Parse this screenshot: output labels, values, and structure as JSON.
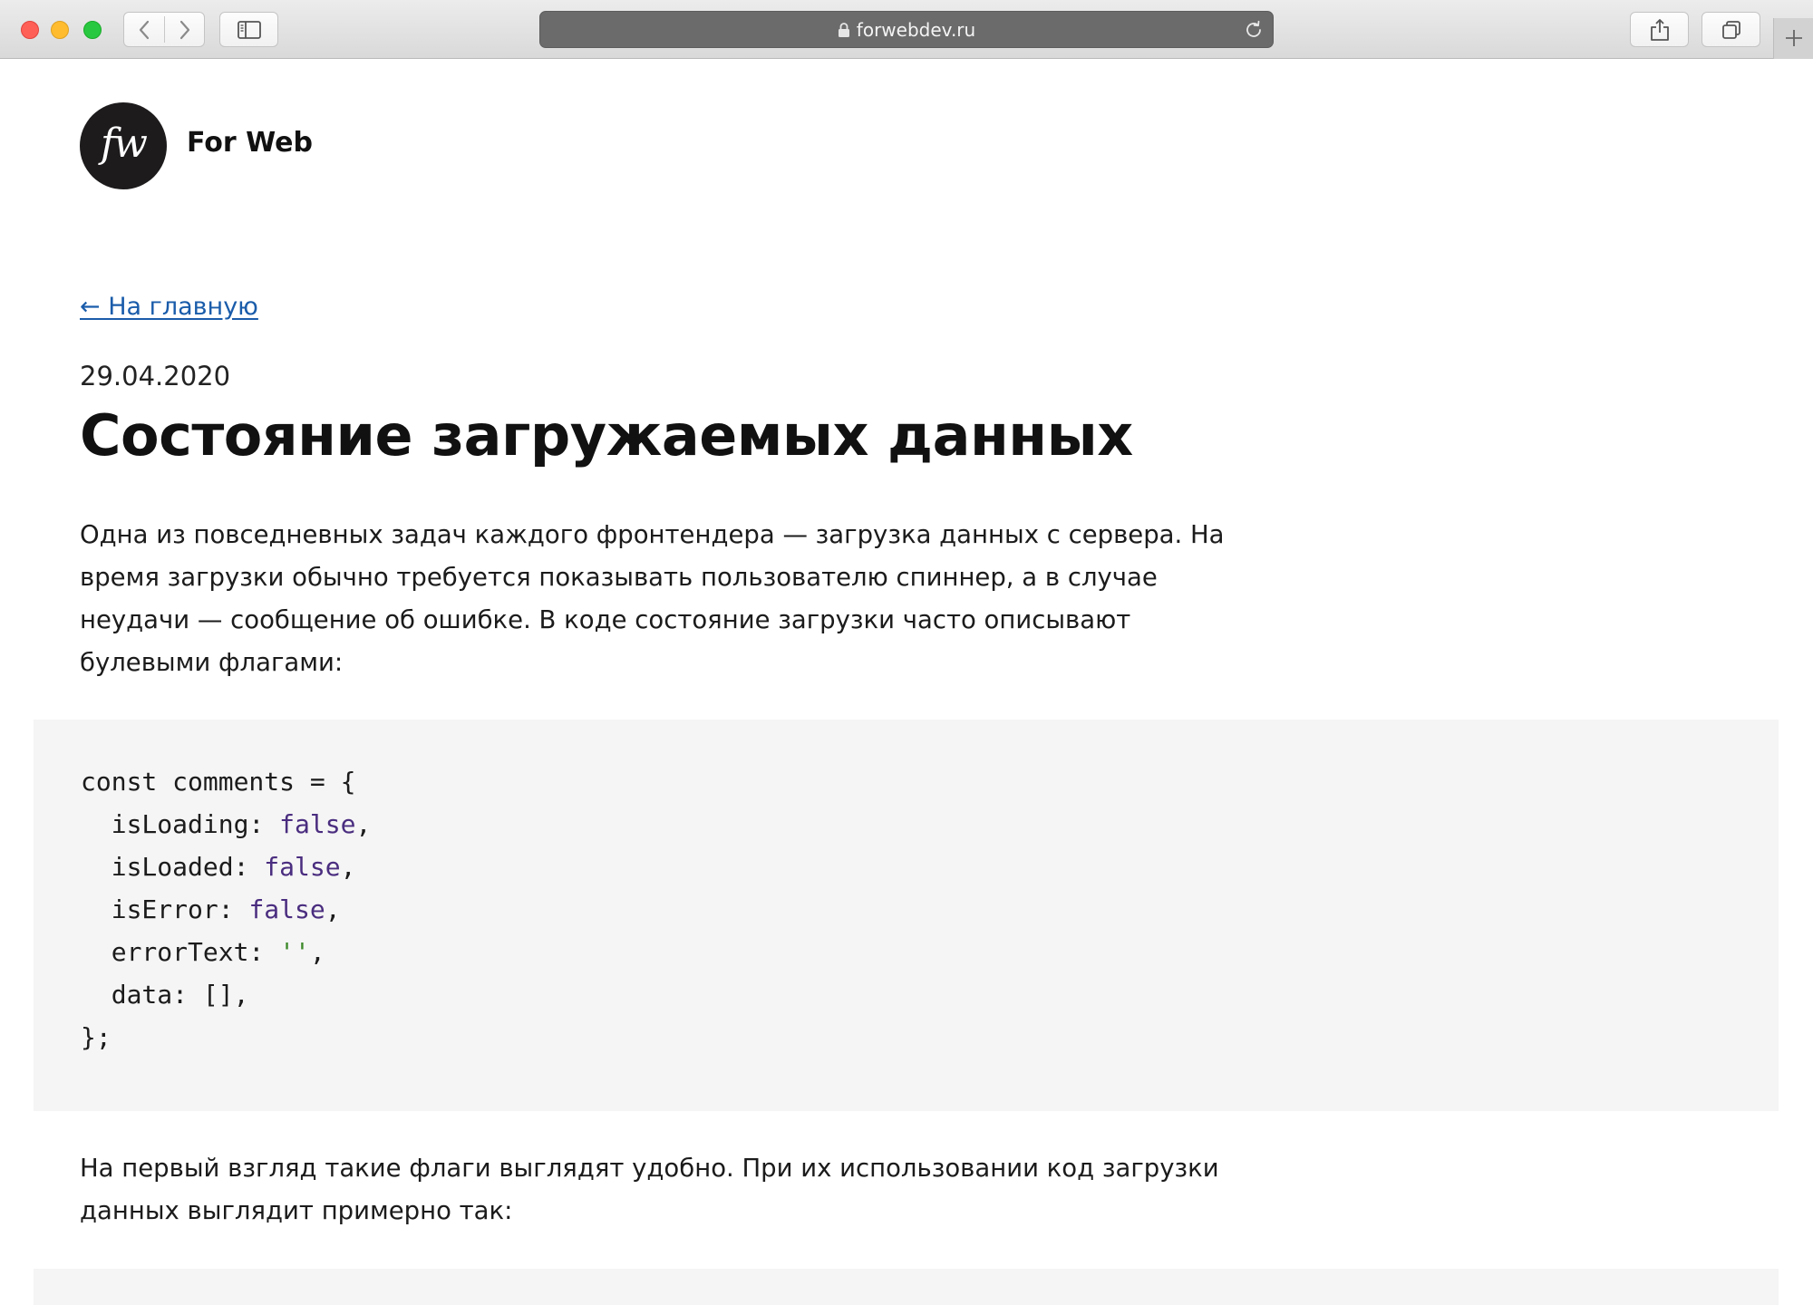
{
  "browser": {
    "url": "forwebdev.ru"
  },
  "site": {
    "logo_text": "fw",
    "name": "For Web"
  },
  "article": {
    "back_link": "← На главную",
    "date": "29.04.2020",
    "title": "Состояние загружаемых данных",
    "intro": "Одна из повседневных задач каждого фронтендера — загрузка данных с сервера. На время загрузки обычно требуется показывать пользователю спиннер, а в случае неудачи — сообщение об ошибке. В коде состояние загрузки часто описывают булевыми флагами:",
    "code": {
      "line1": "const comments = {",
      "line2_key": "  isLoading: ",
      "line2_val": "false",
      "line3_key": "  isLoaded: ",
      "line3_val": "false",
      "line4_key": "  isError: ",
      "line4_val": "false",
      "line5_key": "  errorText: ",
      "line5_val": "''",
      "line6": "  data: [],",
      "line7": "};",
      "comma": ","
    },
    "followup": "На первый взгляд такие флаги выглядят удобно. При их использовании код загрузки данных выглядит примерно так:"
  },
  "colors": {
    "link": "#1a5caa",
    "keyword": "#4a2d7f",
    "string": "#3e8a2a",
    "code_background": "#f5f5f5"
  },
  "icons": {
    "back": "chevron-left-icon",
    "forward": "chevron-right-icon",
    "sidebar": "sidebar-icon",
    "lock": "lock-icon",
    "reload": "reload-icon",
    "share": "share-icon",
    "tabs": "tabs-icon",
    "new_tab": "plus-icon"
  }
}
